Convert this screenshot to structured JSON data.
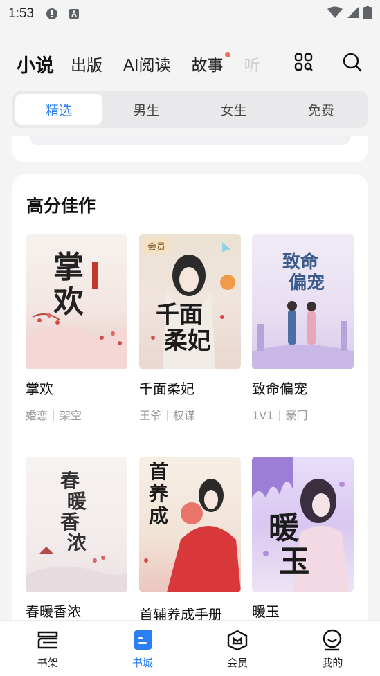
{
  "status_bar": {
    "time": "1:53"
  },
  "top_nav": {
    "tabs": [
      "小说",
      "出版",
      "AI阅读",
      "故事",
      "听"
    ]
  },
  "sub_tabs": [
    "精选",
    "男生",
    "女生",
    "免费"
  ],
  "section": {
    "title": "高分佳作",
    "books": [
      {
        "title": "掌欢",
        "tags": [
          "婚恋",
          "架空"
        ],
        "cover_text": "掌欢",
        "vip": ""
      },
      {
        "title": "千面柔妃",
        "tags": [
          "王爷",
          "权谋"
        ],
        "cover_text": "千面柔妃",
        "vip": "会员"
      },
      {
        "title": "致命偏宠",
        "tags": [
          "1V1",
          "豪门"
        ],
        "cover_text": "致命偏宠",
        "vip": ""
      },
      {
        "title": "春暖香浓",
        "tags": [],
        "cover_text": "春暖香浓",
        "vip": ""
      },
      {
        "title": "首辅养成手册",
        "tags": [],
        "cover_text": "首辅养成手册",
        "vip": ""
      },
      {
        "title": "暖玉",
        "tags": [],
        "cover_text": "暖玉",
        "vip": ""
      }
    ]
  },
  "bottom_nav": [
    "书架",
    "书城",
    "会员",
    "我的"
  ],
  "colors": {
    "accent": "#2a7ff5",
    "dot": "#f07060"
  }
}
